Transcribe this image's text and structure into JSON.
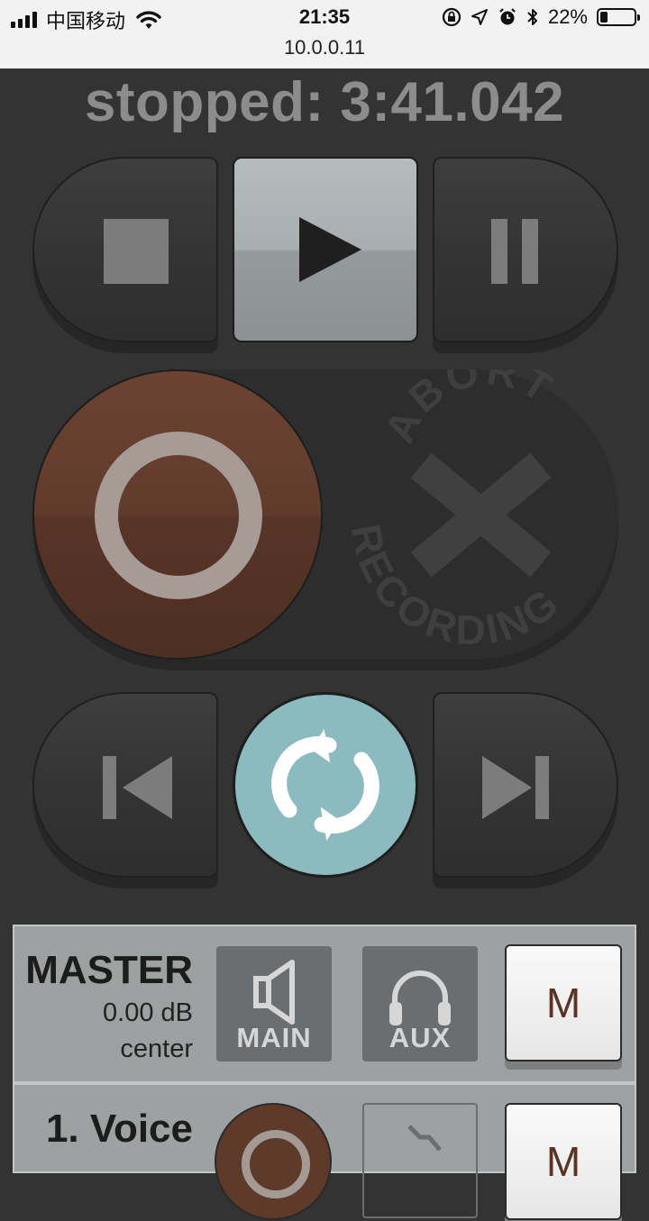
{
  "status_bar": {
    "carrier": "中国移动",
    "time": "21:35",
    "url": "10.0.0.11",
    "battery_percent": "22%",
    "battery_level": 0.22,
    "icons": [
      "signal-icon",
      "wifi-icon",
      "orientation-lock-icon",
      "location-icon",
      "alarm-icon",
      "bluetooth-icon",
      "battery-icon"
    ]
  },
  "transport": {
    "status_text": "stopped: 3:41.042",
    "stop_icon": "stop-icon",
    "play_icon": "play-icon",
    "pause_icon": "pause-icon",
    "record_icon": "record-icon",
    "abort_icon": "abort-x-icon",
    "abort_top_text": "ABORT",
    "abort_bottom_text": "RECORDING",
    "prev_icon": "skip-to-start-icon",
    "loop_icon": "loop-icon",
    "next_icon": "skip-to-end-icon"
  },
  "colors": {
    "background": "#333333",
    "play_active": "#a7aeb1",
    "record": "#603b2c",
    "loop": "#8bbbbf",
    "strip": "#9ea1a2"
  },
  "strips": [
    {
      "name": "MASTER",
      "gain": "0.00 dB",
      "pan": "center",
      "main_label": "MAIN",
      "aux_label": "AUX",
      "mute_label": "M"
    },
    {
      "name": "1. Voice",
      "mute_label": "M"
    }
  ]
}
